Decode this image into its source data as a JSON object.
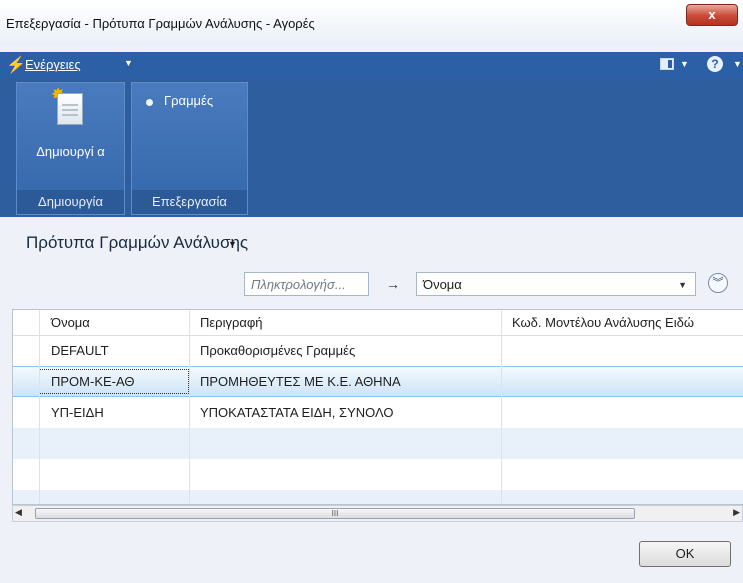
{
  "window": {
    "title": "Επεξεργασία - Πρότυπα Γραμμών Ανάλυσης - Αγορές",
    "close_label": "x"
  },
  "actionbar": {
    "actions_label": "Ενέργειες",
    "help_label": "?"
  },
  "ribbon": {
    "groups": [
      {
        "label": "Δημιουργία",
        "button_label": "Δημιουργί α"
      },
      {
        "label": "Επεξεργασία",
        "button_label": "Γραμμές"
      }
    ]
  },
  "page": {
    "section_title": "Πρότυπα Γραμμών Ανάλυσης",
    "search_placeholder": "Πληκτρολογήσ...",
    "filter_column": "Όνομα"
  },
  "table": {
    "columns": [
      "Όνομα",
      "Περιγραφή",
      "Κωδ. Μοντέλου Ανάλυσης Ειδώ"
    ],
    "rows": [
      [
        "DEFAULT",
        "Προκαθορισμένες Γραμμές",
        ""
      ],
      [
        "ΠΡΟΜ-ΚΕ-ΑΘ",
        "ΠΡΟΜΗΘΕΥΤΕΣ ΜΕ Κ.Ε. ΑΘΗΝΑ",
        ""
      ],
      [
        "ΥΠ-ΕΙΔΗ",
        "ΥΠΟΚΑΤΑΣΤΑΤΑ ΕΙΔΗ, ΣΥΝΟΛΟ",
        ""
      ]
    ],
    "selected_row": 1
  },
  "scrollbar": {
    "thumb_label": "III"
  },
  "footer": {
    "ok_label": "OK"
  },
  "colors": {
    "actionbar": "#2b60a6",
    "ribbon": "#2e5e9e",
    "selected_row": "#cde4f7",
    "close_button": "#c94a38"
  }
}
